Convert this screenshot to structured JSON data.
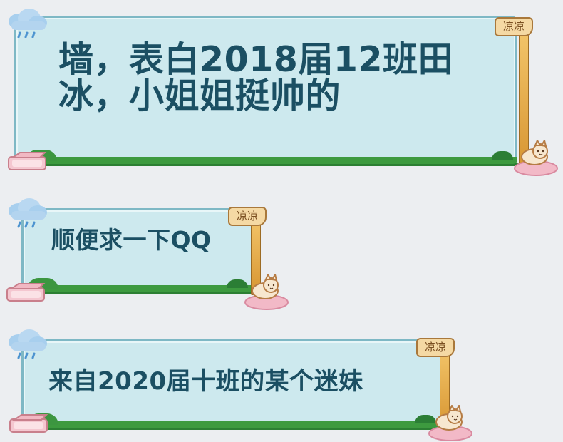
{
  "bubbles": [
    {
      "text": "墙，表白2018届12班田冰，小姐姐挺帅的",
      "sign": "凉凉"
    },
    {
      "text": "顺便求一下QQ",
      "sign": "凉凉"
    },
    {
      "text": "来自2020届十班的某个迷妹",
      "sign": "凉凉"
    }
  ],
  "icons": {
    "cloud": "rain-cloud-icon",
    "blanket": "blanket-icon",
    "cat": "cat-on-cushion-icon",
    "signpost": "signpost-icon"
  },
  "colors": {
    "page_background": "#eceef1",
    "bubble_fill": "#cde9ee",
    "bubble_border": "#7eb8c5",
    "grass": "#3d9a3f",
    "text": "#1b4f63",
    "sign": "#f5d9a4"
  }
}
